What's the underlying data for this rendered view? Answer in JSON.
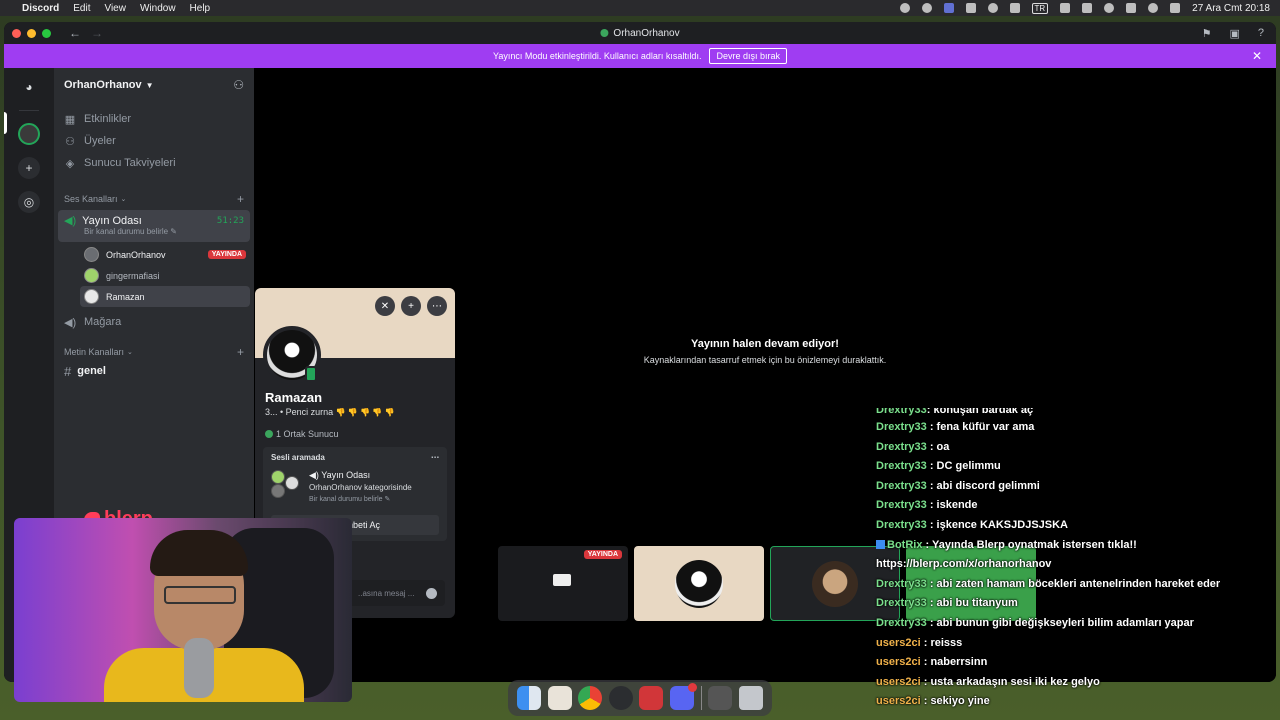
{
  "menubar": {
    "app_name": "Discord",
    "menus": [
      "Edit",
      "View",
      "Window",
      "Help"
    ],
    "input_badge": "TR",
    "datetime": "27 Ara Cmt  20:18"
  },
  "window": {
    "title": "OrhanOrhanov",
    "banner_text": "Yayıncı Modu etkinleştirildi. Kullanıcı adları kısaltıldı.",
    "banner_button": "Devre dışı bırak"
  },
  "sidebar": {
    "server_name": "OrhanOrhanov",
    "items": [
      {
        "label": "Etkinlikler",
        "icon": "calendar-icon"
      },
      {
        "label": "Üyeler",
        "icon": "members-icon"
      },
      {
        "label": "Sunucu Takviyeleri",
        "icon": "boost-icon"
      }
    ],
    "voice_category": "Ses Kanalları",
    "voice_channel": {
      "name": "Yayın Odası",
      "timer": "51:23",
      "status_placeholder": "Bir kanal durumu belirle",
      "users": [
        {
          "name": "OrhanOrhanov",
          "badge": "YAYINDA"
        },
        {
          "name": "gingermafiasi",
          "badge": ""
        },
        {
          "name": "Ramazan",
          "badge": ""
        }
      ]
    },
    "stage_channel": "Mağara",
    "text_category": "Metin Kanalları",
    "text_channel": "genel"
  },
  "overlay_logo": "blerp",
  "stage": {
    "paused_title": "Yayının halen devam ediyor!",
    "paused_sub": "Kaynaklarından tasarruf etmek için bu önizlemeyi duraklattık.",
    "tile_live_badge": "YAYINDA"
  },
  "profile": {
    "name": "Ramazan",
    "status": "3... • Penci zurna",
    "status_emoji": "👎 👎 👎 👎 👎",
    "mutual": "1 Ortak Sunucu",
    "voice_header": "Sesli aramada",
    "voice_channel": "Yayın Odası",
    "voice_category": "OrhanOrhanov kategorisinde",
    "voice_status": "Bir kanal durumu belirle",
    "chat_button": "Sohbeti Aç",
    "message_placeholder": "..asına mesaj ..."
  },
  "chat": [
    {
      "user": "Drextry33",
      "msg": ": konuşan bardak aç",
      "color": "green"
    },
    {
      "user": "Drextry33",
      "msg": ": fena küfür var ama",
      "color": "green"
    },
    {
      "user": "Drextry33",
      "msg": ": oa",
      "color": "green"
    },
    {
      "user": "Drextry33",
      "msg": ": DC gelimmu",
      "color": "green"
    },
    {
      "user": "Drextry33",
      "msg": ": abi discord gelimmi",
      "color": "green"
    },
    {
      "user": "Drextry33",
      "msg": ": iskende",
      "color": "green"
    },
    {
      "user": "Drextry33",
      "msg": ": işkence KAKSJDJSJSKA",
      "color": "green"
    },
    {
      "user": "BotRix",
      "msg": ": Yayında Blerp oynatmak istersen tıkla!!",
      "color": "bot"
    },
    {
      "user": "",
      "msg": "https://blerp.com/x/orhanorhanov",
      "color": "green"
    },
    {
      "user": "Drextry33",
      "msg": ": abi zaten hamam böcekleri antenelrinden hareket eder",
      "color": "green"
    },
    {
      "user": "Drextry33",
      "msg": ": abi bu titanyum",
      "color": "green"
    },
    {
      "user": "Drextry33",
      "msg": ": abi bunun gibi değişkseyleri bilim adamları yapar",
      "color": "green"
    },
    {
      "user": "users2ci",
      "msg": ": reisss",
      "color": "yellow"
    },
    {
      "user": "users2ci",
      "msg": ": naberrsinn",
      "color": "yellow"
    },
    {
      "user": "users2ci",
      "msg": ": usta arkadaşın sesi iki kez gelyo",
      "color": "yellow"
    },
    {
      "user": "users2ci",
      "msg": ": sekiyo yine",
      "color": "yellow"
    }
  ]
}
